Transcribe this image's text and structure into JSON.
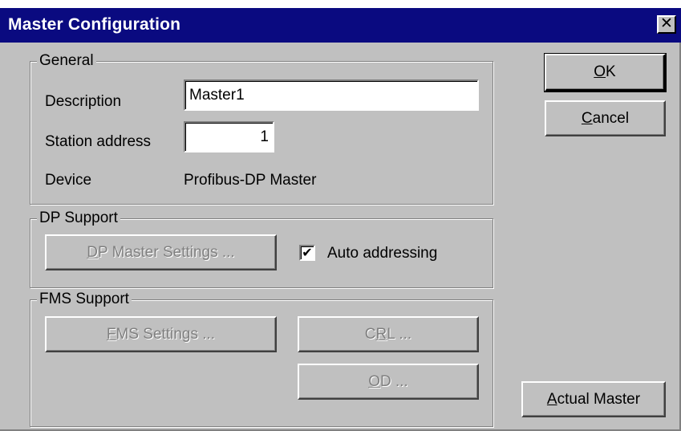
{
  "window": {
    "title": "Master Configuration",
    "close_glyph": "✕"
  },
  "general": {
    "legend": "General",
    "description_label": "Description",
    "description_value": "Master1",
    "station_label": "Station address",
    "station_value": "1",
    "device_label": "Device",
    "device_value": "Profibus-DP Master"
  },
  "dp_support": {
    "legend": "DP Support",
    "settings_button": {
      "mnemonic": "D",
      "rest": "P Master Settings ..."
    },
    "auto_addressing_label": "Auto addressing",
    "auto_addressing_checked": true,
    "check_glyph": "✔"
  },
  "fms_support": {
    "legend": "FMS Support",
    "settings_button": {
      "mnemonic": "F",
      "rest": "MS Settings ..."
    },
    "crl_button": {
      "pre": "C",
      "mnemonic": "R",
      "rest": "L ..."
    },
    "od_button": {
      "mnemonic": "O",
      "rest": "D ..."
    }
  },
  "buttons": {
    "ok": {
      "mnemonic": "O",
      "rest": "K"
    },
    "cancel": {
      "mnemonic": "C",
      "rest": "ancel"
    },
    "actual_master": {
      "mnemonic": "A",
      "rest": "ctual Master"
    }
  },
  "colors": {
    "titlebar": "#0a0a80",
    "face": "#c0c0c0",
    "disabled_text": "#808080"
  }
}
